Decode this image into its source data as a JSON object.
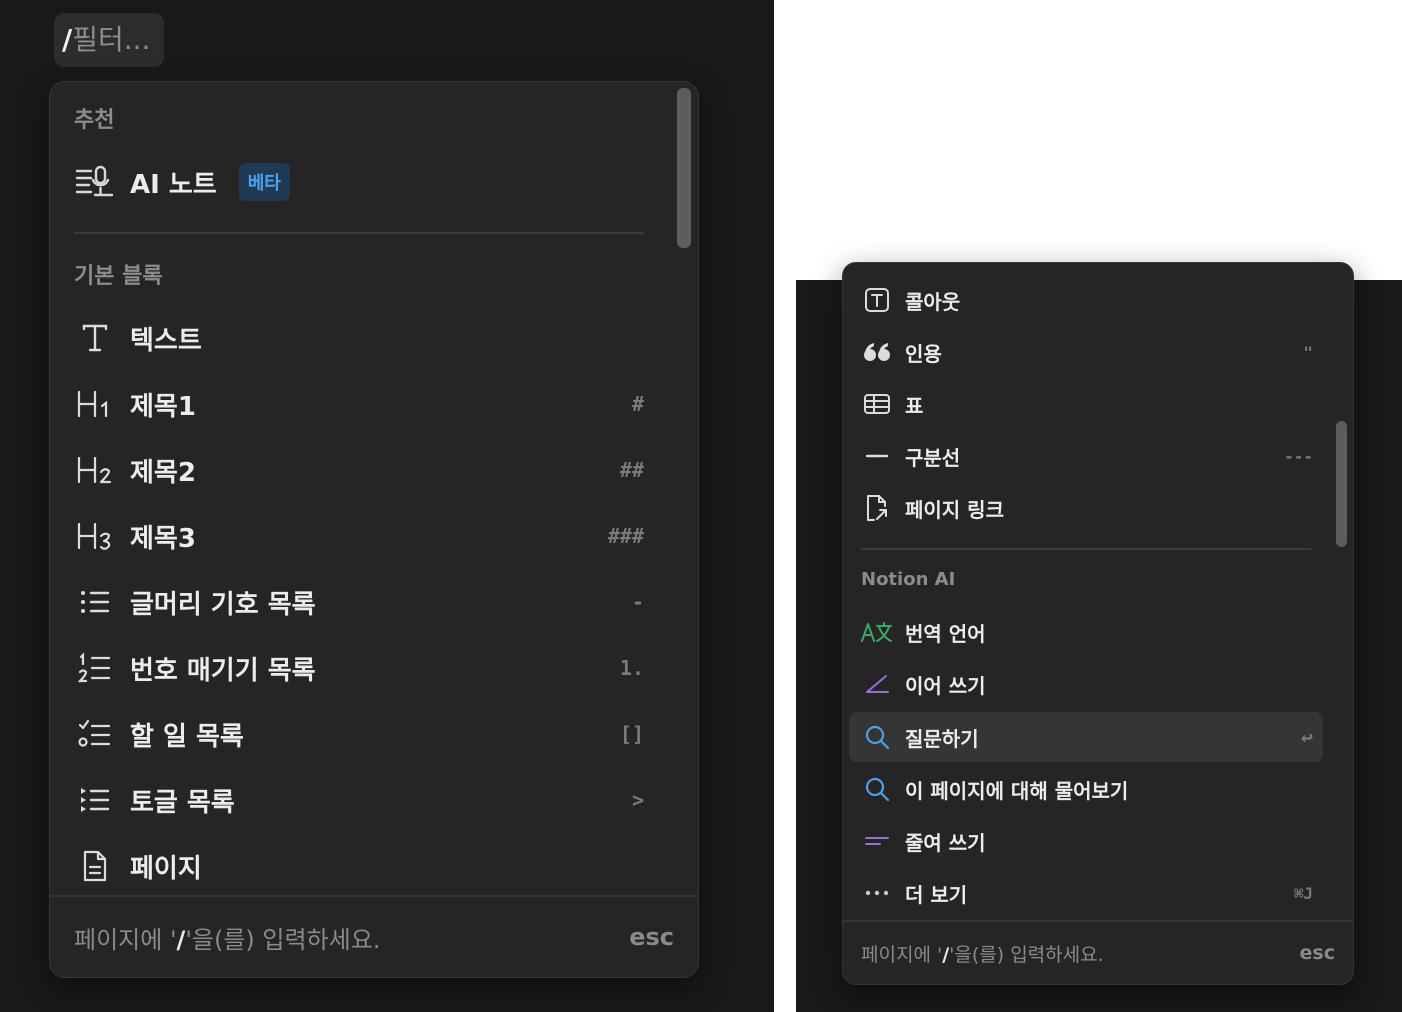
{
  "filter": {
    "prefix": "/",
    "placeholder": "필터..."
  },
  "left_menu": {
    "sections": {
      "recommended": "추천",
      "basic_blocks": "기본 블록"
    },
    "ai_note": {
      "label": "AI 노트",
      "badge": "베타"
    },
    "items": [
      {
        "label": "텍스트",
        "shortcut": "",
        "icon": "text-icon"
      },
      {
        "label": "제목1",
        "shortcut": "#",
        "icon": "heading1-icon"
      },
      {
        "label": "제목2",
        "shortcut": "##",
        "icon": "heading2-icon"
      },
      {
        "label": "제목3",
        "shortcut": "###",
        "icon": "heading3-icon"
      },
      {
        "label": "글머리 기호 목록",
        "shortcut": "-",
        "icon": "bulleted-list-icon"
      },
      {
        "label": "번호 매기기 목록",
        "shortcut": "1.",
        "icon": "numbered-list-icon"
      },
      {
        "label": "할 일 목록",
        "shortcut": "[]",
        "icon": "todo-list-icon"
      },
      {
        "label": "토글 목록",
        "shortcut": ">",
        "icon": "toggle-list-icon"
      },
      {
        "label": "페이지",
        "shortcut": "",
        "icon": "page-icon"
      }
    ],
    "footer": {
      "prefix": "페이지에 '",
      "slash": "/",
      "suffix": "'을(를) 입력하세요.",
      "esc": "esc"
    }
  },
  "right_menu": {
    "items": [
      {
        "label": "콜아웃",
        "shortcut": "",
        "icon": "callout-icon"
      },
      {
        "label": "인용",
        "shortcut": "\"",
        "icon": "quote-icon"
      },
      {
        "label": "표",
        "shortcut": "",
        "icon": "table-icon"
      },
      {
        "label": "구분선",
        "shortcut": "---",
        "icon": "divider-icon"
      },
      {
        "label": "페이지 링크",
        "shortcut": "",
        "icon": "page-link-icon"
      }
    ],
    "ai_section": "Notion AI",
    "ai_items": [
      {
        "label": "번역 언어",
        "shortcut": "",
        "icon": "translate-icon",
        "icon_color": "#3aa868"
      },
      {
        "label": "이어 쓰기",
        "shortcut": "",
        "icon": "pen-icon",
        "icon_color": "#9b6bd8"
      },
      {
        "label": "질문하기",
        "shortcut": "↩",
        "icon": "search-icon",
        "icon_color": "#4e9ee8",
        "selected": true
      },
      {
        "label": "이 페이지에 대해 물어보기",
        "shortcut": "",
        "icon": "search-icon",
        "icon_color": "#4e9ee8"
      },
      {
        "label": "줄여 쓰기",
        "shortcut": "",
        "icon": "shorten-icon",
        "icon_color": "#9b6bd8"
      },
      {
        "label": "더 보기",
        "shortcut": "⌘J",
        "icon": "more-icon",
        "icon_color": "#c8c8c8"
      }
    ],
    "footer": {
      "prefix": "페이지에 '",
      "slash": "/",
      "suffix": "'을(를) 입력하세요.",
      "esc": "esc"
    }
  }
}
